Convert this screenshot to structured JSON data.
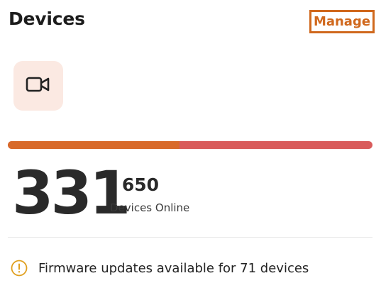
{
  "header": {
    "title": "Devices",
    "manage_label": "Manage"
  },
  "device_icon": "video-camera-icon",
  "stats": {
    "online": "331",
    "total": "/ 650",
    "label": "Devices Online",
    "online_fraction": 0.47
  },
  "notice": {
    "icon": "warning-circle-icon",
    "text": "Firmware updates available for 71 devices"
  },
  "colors": {
    "accent": "#d0681d",
    "progress_fill": "#d86a2a",
    "progress_track": "#d95c5c",
    "icon_tile_bg": "#fbe9e2",
    "notice_icon": "#e0a020"
  }
}
